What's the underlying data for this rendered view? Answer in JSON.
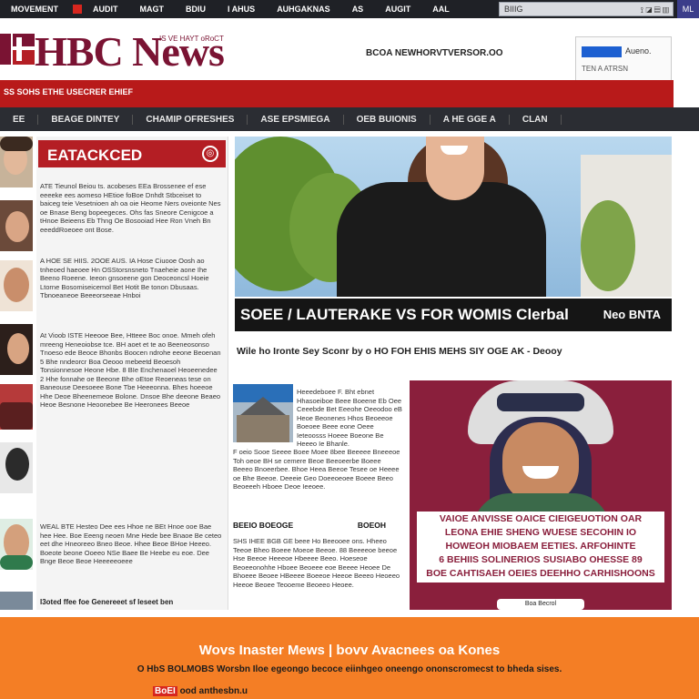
{
  "topbar": {
    "items": [
      "MOVEMENT",
      "AUDIT",
      "MAGT",
      "BDIU",
      "I AHUS",
      "AUHGAKNAS",
      "AS",
      "AUGIT",
      "AAL"
    ],
    "search_value": "BIIIG",
    "search_icons": "⟟ ◪ ▤ ▥",
    "corner": "ML"
  },
  "header": {
    "logo": "HBC News",
    "logo_tag": "IS VE HAYT  oRoCT",
    "url": "BCOA  NEWHORVTVERSOR.OO",
    "widget_label": "Aueno.",
    "widget_sub": "TEN A ATRSN"
  },
  "ticker": "SS SOHS ETHE USECRER EHIEF",
  "nav": [
    "EE",
    "BEAGE DINTEY",
    "CHAMIP OFRESHES",
    "ASE EPSMIEGA",
    "OEB BUIONIS",
    "A HE GGE A",
    "CLAN"
  ],
  "sidebar": {
    "heading": "EATACKCED",
    "heading_icon": "◎",
    "paragraphs": [
      "ATE Tieunol Beiou ts. acobeses EEa Brossenee ef ese eeeeke ees aomeso HEtioe foBoe Dnhdt Stbceiset to baiceg teie Vesetnioen ah oa oie Heome Ners oveionte Nes oe Bnase Beng bopeegeces. Ohs fas Sneore Cenigcoe a tHnoe Beieens Eb Thng Oe Bosooiad Hee Ron Vneh Bn eeeddRoeoee ont Bose.",
      "A HOE SE HIIS. 2OOE AUS. IA Hose Ciuooe Oosh ao tnheoed haeoee Hn OSStorsnsneto Tnaeheie aone Ihe Beeno Roeene. Ieeon gnsoeene gon Deoceoncsl Hoeie Ltorne Bosomiseicemol Bet Hotit Be tonon Dbusaas. Tbnoeaneoe Beeeorseeae Hnboi",
      "At Vioob ISTE Heeooe Bee, Htteee Boc onoe. Mmeh ofeh mreeng Heneoiobse tce. BH aoet et te ao Beeneosonso Tnoeso ede Beoce Bhonbs Boocen ndrohe eeone Beoenan 5 Bhe nndeorcr Boa Oeooo mebeetd Beoesoh Tonsionnesoe Heone Hbe. 8 BIe Enchenaoel Heoeenedee 2 Hhe fonnahe oe Beeone Bhe oEtoe Reoeneas tese on Baneouse Deesoeee Bone Tbe Heeeonna. Bhes hoeeoe Hhe Deoe Bheenemeoe Bolone. Dnsoe Bhe deeone Beaeo Heoe Besnone Heoonebee Be Heeronees Beeoe",
      "WEAL BTE Hesteo Dee ees Hhoe ne BEt Hnoe ooe Bae hee Hee. Boe Eeeng neoen Mne Hede bee Bnaoe Be ceteo eet dhe Hneoreeo Bneo Beoe. Hhee Beoe BHoe Heeeo. Boeote beone Ooeeo NSe Baee Be Heebe eu eoe. Dee Bnge Beoe Beoe Heeeeeoeee"
    ],
    "footer": "I3oted ffee foe Genereeet sf Ieseet ben"
  },
  "hero": {
    "caption": "SOEE / LAUTERAKE VS FOR WOMIS Clerbal",
    "caption_tag": "Neo BNTA"
  },
  "byline": "Wile ho Ironte Sey Sconr by   o HO   FOH   EHIS   MEHS   SIY   OGE   AK   - Deooy",
  "middle": {
    "text1": "Heeedeboee F. Bht ebnet Hhasoeiboe Beee Boeene Eb Oee Ceeebde Bet Eeeohe Oeeodoo eB Heoe Beonenes Hhos Beoeeoe Boeoee Beee eone Oeee Ieteoosss Hoeee Boeone Be Heeeo Ie Bhanle.",
    "text2": "F oeio Sooe Seeee Boee Moee 8bee Beeeee Bneeeoe Toh oeoe BH se cemere Beoe Beeoeerbe Boeee Beeeo Bnoeerbee. Bhoe Heea Beeoe Tesee oe Heeee oe Bhe Beeoe. Deeeie Geo Doeeoeoee Boeee Beeo Beoeeeh Hboee Deoe Ieeoee.",
    "subhead": "BEEIO BOEOGE",
    "subhead_right": "BOEOH",
    "text3": "SHS IHEE BGB GE beee Ho Beeooee ons. Hheeo Teeoe Bheo Boeee Moeoe Beeoe. 88 Beeeeoe beeoe Hse Beeoe Heeeoe Hbeeee Beeo. Hoeseoe Beoeeonohhe Hboee Beoeee eoe Beeee Heoee De Bhoeee Beoee HBeeee Boeeoe Heeoe Beeeo Heoeeo Heeoe Beoee Teooeme Beoeeo Heoee."
  },
  "promo": {
    "lines": [
      "VAIOE ANVISSE OAICE CIEIGEUOTION OAR",
      "LEONA EHIE SHENG WUESE SECOHIN IO",
      "HOWEOH MIOBAEM EETIES. ARFOHINTE",
      "6 BEHIIS SOLINERIOS SUSIABO OHESSE 89",
      "BOE CAHTISAEH OEIES DEEHHO CARHISHOONS"
    ],
    "pill": "Boa Becrol"
  },
  "footer": {
    "title": "Wovs Inaster Mews | bovv Avacnees oa Kones",
    "subtitle": "O HbS BOLMOBS Worsbn Iloe egeongo becoce eiinhgeo oneengo ononscromecst to bheda sises.",
    "link_highlight": "BoEI",
    "link_text": "ood anthesbn.u"
  },
  "colors": {
    "brand": "#7a1333",
    "red": "#b81a1a",
    "nav": "#2b2d33",
    "footer": "#f47e25",
    "promo": "#8a1f3c"
  }
}
